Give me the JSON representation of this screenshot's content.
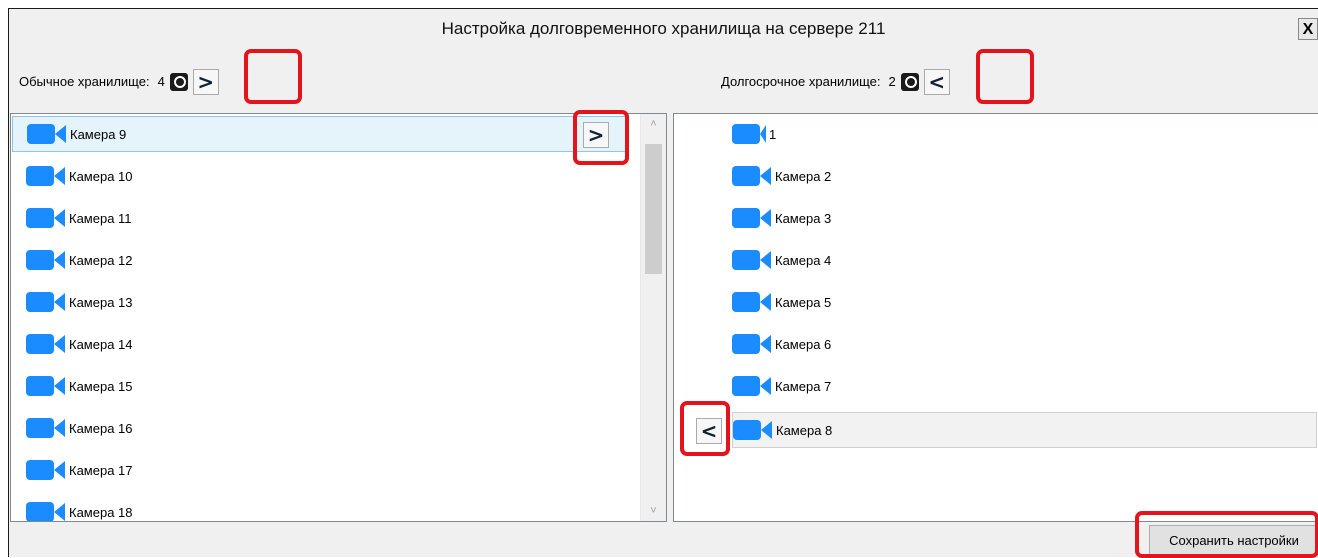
{
  "dialog": {
    "title": "Настройка долговременного хранилища на сервере 211",
    "close_label": "X"
  },
  "left": {
    "header_label": "Обычное хранилище:",
    "count": "4",
    "move_all_glyph": ">",
    "row_move_glyph": ">",
    "items": [
      "Камера 9",
      "Камера 10",
      "Камера 11",
      "Камера 12",
      "Камера 13",
      "Камера 14",
      "Камера 15",
      "Камера 16",
      "Камера 17",
      "Камера 18"
    ],
    "selected_index": 0
  },
  "right": {
    "header_label": "Долгосрочное хранилище:",
    "count": "2",
    "move_all_glyph": "<",
    "row_move_glyph": "<",
    "items": [
      "1",
      "Камера 2",
      "Камера 3",
      "Камера 4",
      "Камера 5",
      "Камера 6",
      "Камера 7",
      "Камера 8"
    ],
    "selected_index": 7
  },
  "footer": {
    "save_label": "Сохранить настройки"
  },
  "icons": {
    "camera": "camera-icon",
    "storage": "disk-icon",
    "scroll_up": "chevron-up-icon",
    "scroll_down": "chevron-down-icon"
  },
  "colors": {
    "camera_icon": "#1a8cff",
    "highlight_annotation": "#e3141b",
    "selected_row_left": "#e5f3fb",
    "selected_row_right": "#f2f2f2"
  }
}
